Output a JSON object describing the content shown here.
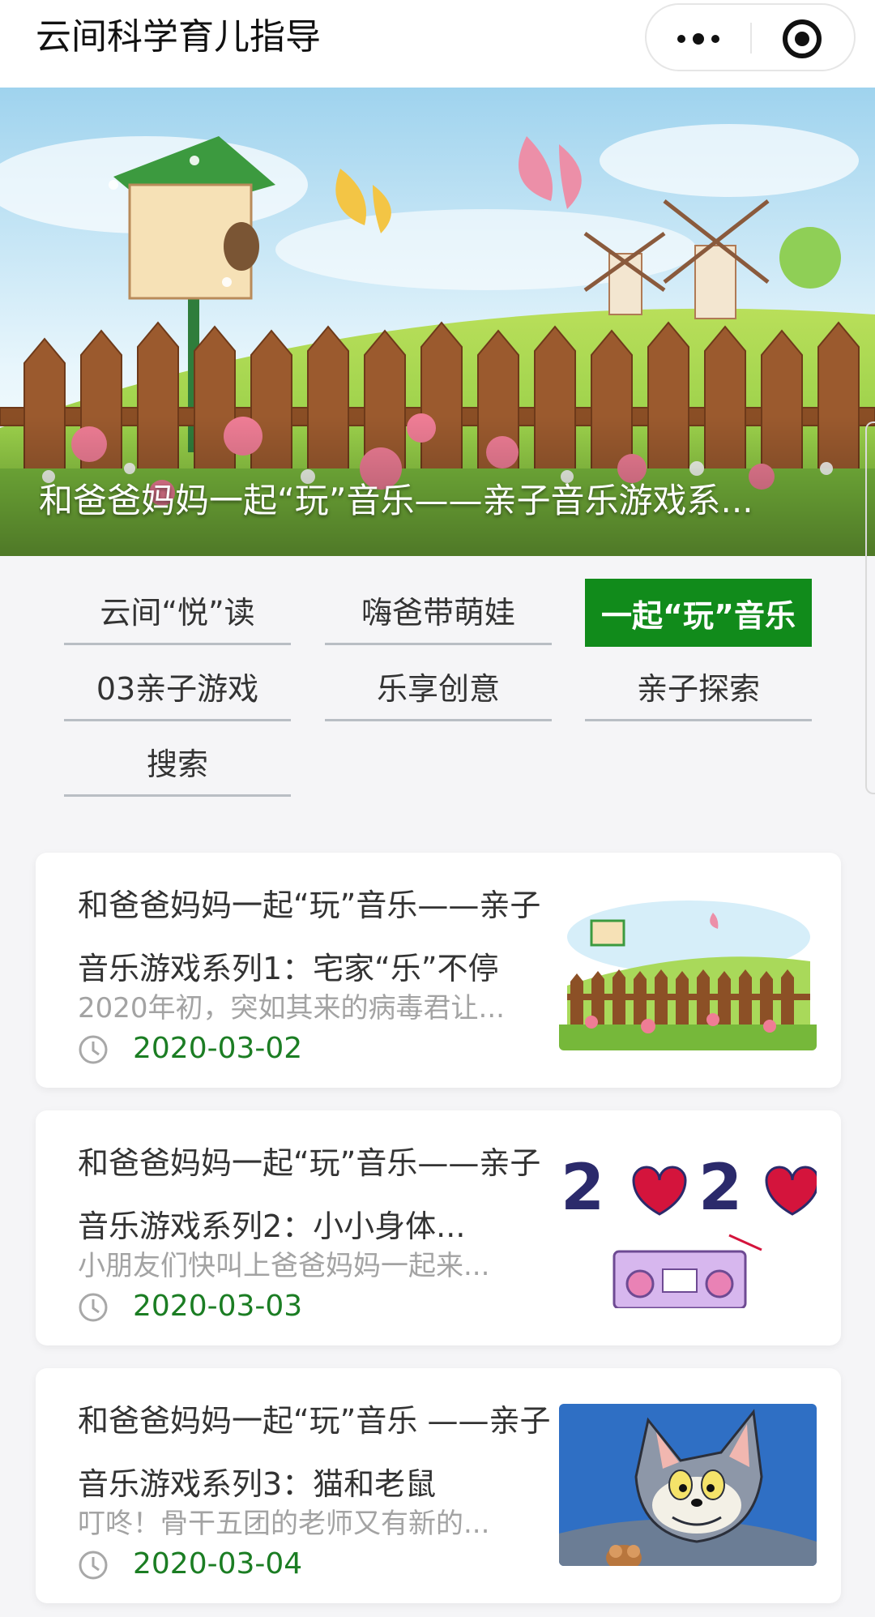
{
  "app": {
    "title": "云间科学育儿指导"
  },
  "capsule": {
    "more_icon": "more-dots-icon",
    "close_icon": "target-close-icon"
  },
  "banner": {
    "caption": "和爸爸妈妈一起“玩”音乐——亲子音乐游戏系..."
  },
  "categories": [
    {
      "label": "云间“悦”读",
      "active": false
    },
    {
      "label": "嗨爸带萌娃",
      "active": false
    },
    {
      "label": "一起“玩”音乐",
      "active": true
    },
    {
      "label": "03亲子游戏",
      "active": false
    },
    {
      "label": "乐享创意",
      "active": false
    },
    {
      "label": "亲子探索",
      "active": false
    },
    {
      "label": "搜索",
      "active": false
    }
  ],
  "articles": [
    {
      "title_line1": "和爸爸妈妈一起“玩”音乐——亲子",
      "title_line2": "音乐游戏系列1：宅家“乐”不停",
      "desc": "2020年初，突如其来的病毒君让...",
      "date": "2020-03-02",
      "thumb": "garden-fence-thumbnail"
    },
    {
      "title_line1": "和爸爸妈妈一起“玩”音乐——亲子",
      "title_line2": "音乐游戏系列2：小小身体...",
      "desc": "小朋友们快叫上爸爸妈妈一起来...",
      "date": "2020-03-03",
      "thumb": "2020-radio-thumbnail"
    },
    {
      "title_line1": "和爸爸妈妈一起“玩”音乐 ——亲子",
      "title_line2": "音乐游戏系列3：猫和老鼠",
      "desc": "叮咚！骨干五团的老师又有新的...",
      "date": "2020-03-04",
      "thumb": "cat-and-mouse-thumbnail"
    }
  ],
  "colors": {
    "accent": "#118b1b",
    "date_green": "#1b7d23",
    "muted": "#a3a3a3",
    "background": "#f5f5f7"
  }
}
